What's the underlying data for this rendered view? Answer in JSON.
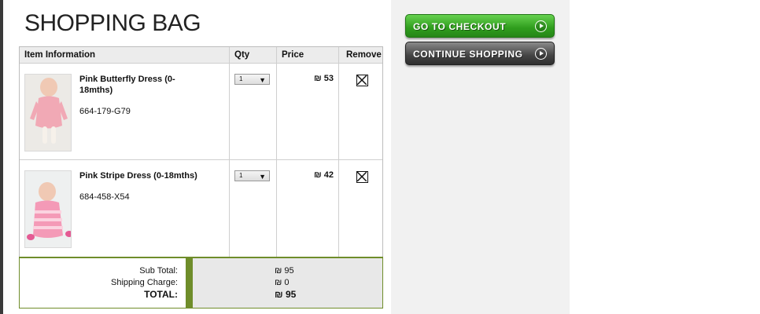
{
  "page": {
    "title": "SHOPPING BAG"
  },
  "table": {
    "headers": {
      "info": "Item Information",
      "qty": "Qty",
      "price": "Price",
      "remove": "Remove"
    },
    "items": [
      {
        "name": "Pink Butterfly Dress (0-18mths)",
        "code": "664-179-G79",
        "qty": "1",
        "price": "₪ 53",
        "image": "baby-in-pink-butterfly-dress"
      },
      {
        "name": "Pink Stripe Dress (0-18mths)",
        "code": "684-458-X54",
        "qty": "1",
        "price": "₪ 42",
        "image": "baby-in-pink-stripe-dress"
      }
    ]
  },
  "totals": {
    "subtotal_label": "Sub Total:",
    "shipping_label": "Shipping Charge:",
    "total_label": "TOTAL:",
    "subtotal_value": "₪ 95",
    "shipping_value": "₪ 0",
    "total_value": "₪ 95"
  },
  "actions": {
    "checkout_label": "GO TO CHECKOUT",
    "continue_label": "CONTINUE SHOPPING"
  },
  "colors": {
    "accent_green": "#6f8d2a",
    "checkout_green": "#2f9d1d",
    "continue_dark": "#444444"
  },
  "icons": {
    "remove": "close-box-icon",
    "qty_dropdown": "triangle-down-icon",
    "cta": "arrow-circle-right-icon"
  }
}
